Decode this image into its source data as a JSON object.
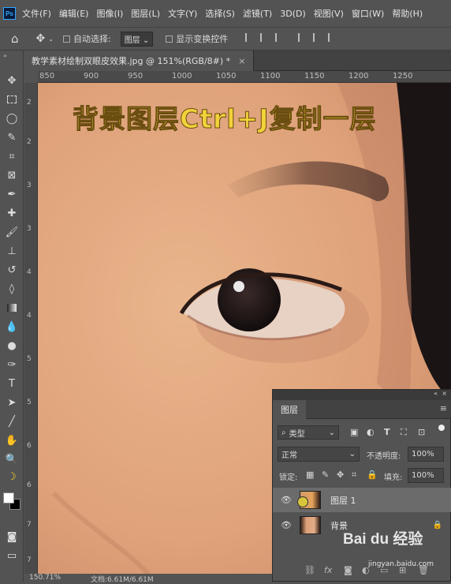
{
  "app": {
    "logo": "Ps"
  },
  "menu": [
    "文件(F)",
    "编辑(E)",
    "图像(I)",
    "图层(L)",
    "文字(Y)",
    "选择(S)",
    "滤镜(T)",
    "3D(D)",
    "视图(V)",
    "窗口(W)",
    "帮助(H)"
  ],
  "options": {
    "auto_select_label": "自动选择:",
    "auto_select_value": "图层",
    "show_transform_label": "显示变换控件"
  },
  "document": {
    "tab_title": "教学素材绘制双眼皮效果.jpg @ 151%(RGB/8#) *",
    "close_glyph": "×"
  },
  "ruler": {
    "top": [
      "850",
      "900",
      "950",
      "1000",
      "1050",
      "1100",
      "1150",
      "1200",
      "1250"
    ],
    "left": [
      "2",
      "2",
      "3",
      "3",
      "4",
      "4",
      "5",
      "5",
      "6",
      "6",
      "7",
      "7"
    ]
  },
  "canvas": {
    "headline": "背景图层Ctrl+J复制一层"
  },
  "status": {
    "zoom": "150.71%",
    "doc_info": "文档:6.61M/6.61M"
  },
  "layers_panel": {
    "tab": "图层",
    "filter_kind": "类型",
    "blend_mode": "正常",
    "opacity_label": "不透明度:",
    "opacity_value": "100%",
    "lock_label": "锁定:",
    "fill_label": "填充:",
    "fill_value": "100%",
    "layers": [
      {
        "name": "图层 1",
        "selected": true
      },
      {
        "name": "背景",
        "selected": false,
        "locked": true
      }
    ]
  },
  "watermark": {
    "brand": "Bai du 经验",
    "url": "jingyan.baidu.com"
  },
  "colors": {
    "ui_bg": "#535353",
    "accent": "#31a8ff",
    "headline": "#f2d23a"
  }
}
